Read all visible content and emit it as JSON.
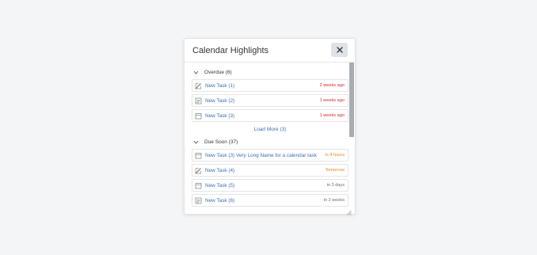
{
  "popover": {
    "title": "Calendar Highlights",
    "close_icon": "close-icon"
  },
  "colors": {
    "overdue": "#d0302f",
    "soon": "#e5841a",
    "neutral": "#6a6d70",
    "link": "#3f6fb3"
  },
  "groups": [
    {
      "label": "Overdue (6)",
      "items": [
        {
          "name": "New Task (1)",
          "due": "2 weeks ago",
          "icon": "edit-icon",
          "status": "overdue"
        },
        {
          "name": "New Task (2)",
          "due": "1 weeks ago",
          "icon": "image-icon",
          "status": "overdue"
        },
        {
          "name": "New Task (3)",
          "due": "1 weeks ago",
          "icon": "calendar-icon",
          "status": "overdue"
        }
      ],
      "load_more": "Load More (3)"
    },
    {
      "label": "Due Soon (37)",
      "items": [
        {
          "name": "New Task (3) Very Long Name for a calendar task",
          "due": "in 4 hours",
          "icon": "calendar-icon",
          "status": "soon"
        },
        {
          "name": "New Task (4)",
          "due": "Tomorrow",
          "icon": "edit-icon",
          "status": "soon"
        },
        {
          "name": "New Task (5)",
          "due": "in 3 days",
          "icon": "calendar-icon",
          "status": "neutral"
        },
        {
          "name": "New Task (6)",
          "due": "in 2 weeks",
          "icon": "image-icon",
          "status": "neutral"
        }
      ]
    }
  ]
}
